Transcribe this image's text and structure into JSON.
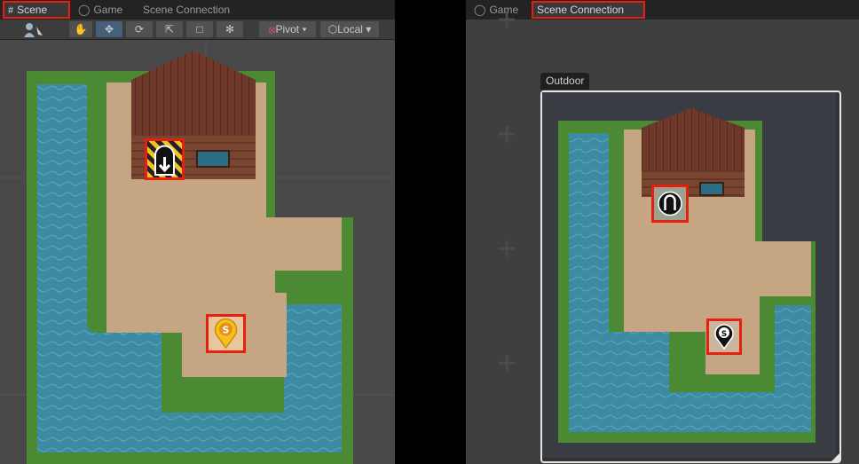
{
  "left_panel": {
    "tabs": [
      {
        "label": "Scene",
        "icon": "grid-icon",
        "active": true,
        "highlighted": true
      },
      {
        "label": "Game",
        "icon": "gamepad-icon",
        "active": false
      },
      {
        "label": "Scene Connection",
        "active": false
      }
    ],
    "toolbar": {
      "tools": [
        "hand-tool-icon",
        "move-tool-icon",
        "rotate-tool-icon",
        "scale-tool-icon",
        "rect-tool-icon",
        "transform-tool-icon"
      ],
      "selected_tool": "move-tool-icon",
      "pivot_label": "Pivot",
      "space_label": "Local"
    }
  },
  "right_panel": {
    "tabs": [
      {
        "label": "Game",
        "icon": "gamepad-icon",
        "active": false
      },
      {
        "label": "Scene Connection",
        "active": true,
        "highlighted": true
      }
    ],
    "node_title": "Outdoor"
  },
  "colors": {
    "highlight": "#e62010",
    "water": "#3f8fa6",
    "ground": "#c6a582",
    "grass": "#4b8a33",
    "roof": "#6b3528"
  }
}
